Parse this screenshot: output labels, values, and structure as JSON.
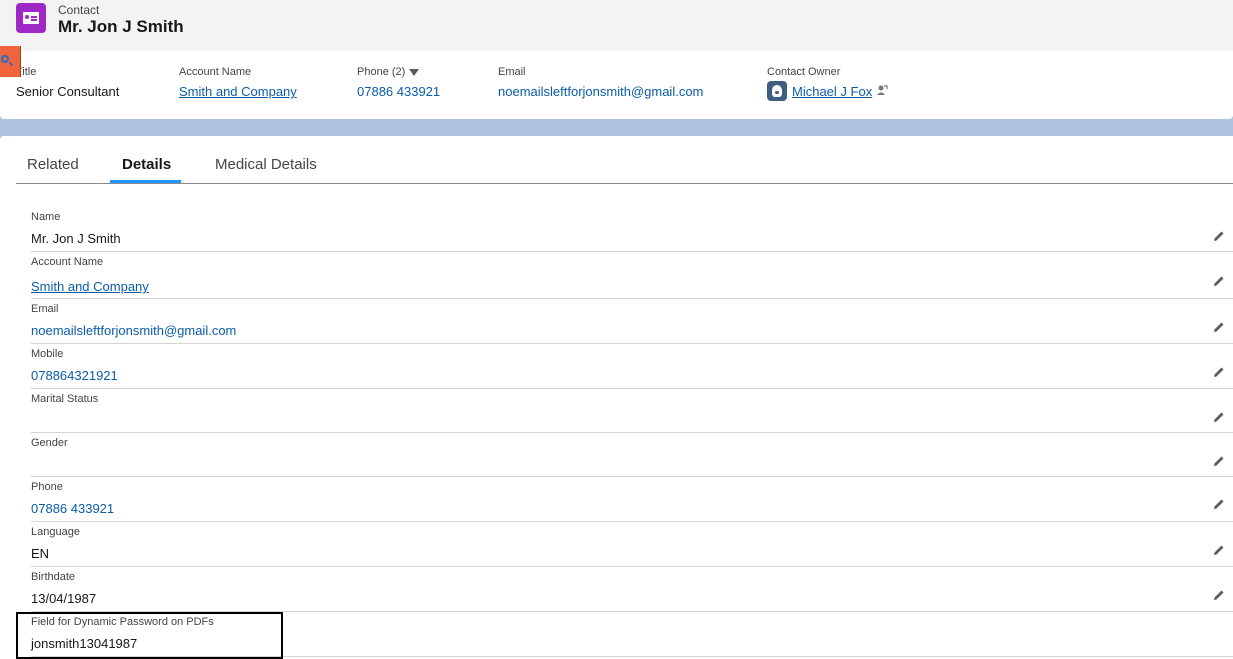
{
  "header": {
    "object_label": "Contact",
    "record_title": "Mr. Jon J Smith"
  },
  "highlights": {
    "title": {
      "label": "Title",
      "value": "Senior Consultant"
    },
    "account_name": {
      "label": "Account Name",
      "value": "Smith and Company"
    },
    "phone": {
      "label": "Phone (2)",
      "value": "07886 433921"
    },
    "email": {
      "label": "Email",
      "value": "noemailsleftforjonsmith@gmail.com"
    },
    "contact_owner": {
      "label": "Contact Owner",
      "value": "Michael J Fox"
    }
  },
  "tabs": [
    {
      "label": "Related"
    },
    {
      "label": "Details"
    },
    {
      "label": "Medical Details"
    }
  ],
  "active_tab": "Details",
  "fields": [
    {
      "label": "Name",
      "value": "Mr. Jon J Smith"
    },
    {
      "label": "Account Name",
      "value": "Smith and Company"
    },
    {
      "label": "Email",
      "value": "noemailsleftforjonsmith@gmail.com"
    },
    {
      "label": "Mobile",
      "value": "078864321921"
    },
    {
      "label": "Marital Status",
      "value": ""
    },
    {
      "label": "Gender",
      "value": ""
    },
    {
      "label": "Phone",
      "value": "07886 433921"
    },
    {
      "label": "Language",
      "value": "EN"
    },
    {
      "label": "Birthdate",
      "value": "13/04/1987"
    },
    {
      "label": "Field for Dynamic Password on PDFs",
      "value": "jonsmith13041987"
    }
  ],
  "colors": {
    "brand_contact": "#9e29c6",
    "link": "#0b5cab",
    "tab_active": "#1b96ff",
    "page_background": "#b0c4df"
  },
  "icons": {
    "header": "contact-card-icon",
    "phone_menu": "chevron-down-icon",
    "owner_avatar": "user-avatar-icon",
    "owner_change": "change-owner-icon",
    "edit": "pencil-icon",
    "search": "search-icon"
  }
}
